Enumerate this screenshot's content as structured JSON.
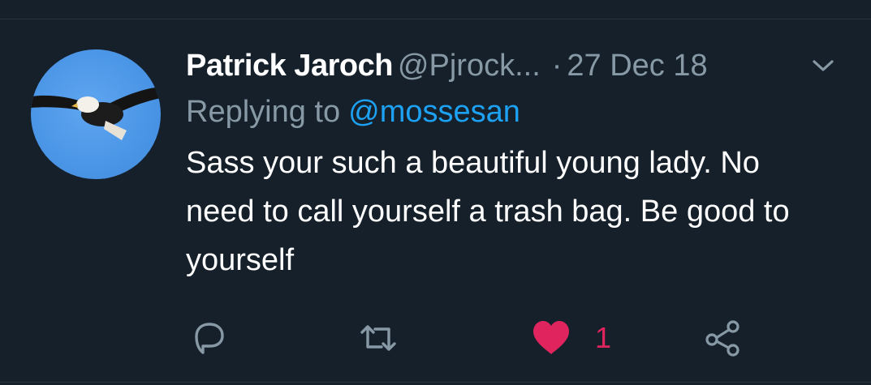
{
  "tweet": {
    "author_name": "Patrick Jaroch",
    "author_handle": "@Pjrock...",
    "separator": "·",
    "date": "27 Dec 18",
    "replying_label": "Replying to",
    "replying_handle": "@mossesan",
    "text": "Sass your such a beautiful young lady. No need to call yourself a trash bag. Be good to yourself"
  },
  "actions": {
    "like_count": "1",
    "liked": true
  },
  "icons": {
    "reply": "reply-bubble-icon",
    "retweet": "retweet-icon",
    "like": "heart-icon",
    "share": "share-icon",
    "menu": "chevron-down-icon"
  },
  "colors": {
    "background": "#15202b",
    "primary_text": "#ffffff",
    "secondary_text": "#8899a6",
    "link": "#1da1f2",
    "like": "#e0245e"
  }
}
